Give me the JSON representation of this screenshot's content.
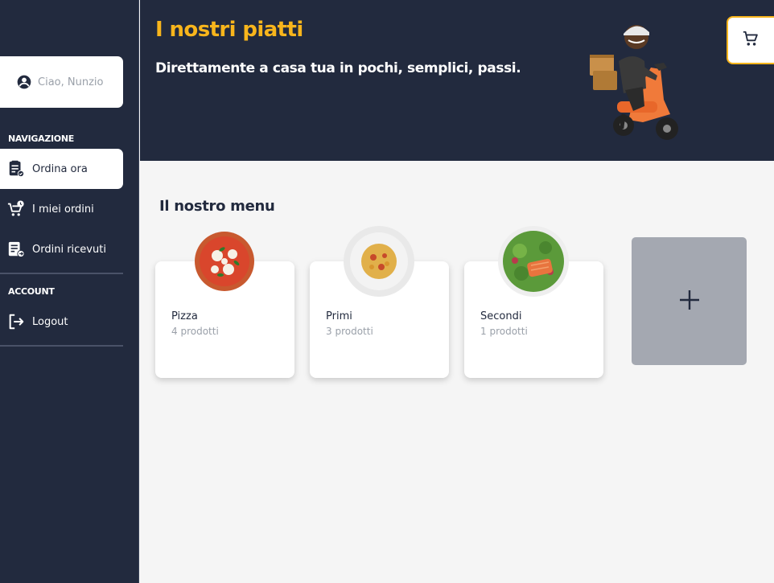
{
  "sidebar": {
    "greeting": "Ciao, Nunzio",
    "nav_section": "NAVIGAZIONE",
    "nav_items": [
      {
        "label": "Ordina ora",
        "icon": "order-list-icon",
        "active": true
      },
      {
        "label": "I miei ordini",
        "icon": "cart-clock-icon",
        "active": false
      },
      {
        "label": "Ordini ricevuti",
        "icon": "received-orders-icon",
        "active": false
      }
    ],
    "account_section": "ACCOUNT",
    "account_items": [
      {
        "label": "Logout",
        "icon": "logout-icon"
      }
    ]
  },
  "hero": {
    "title": "I nostri piatti",
    "subtitle": "Direttamente a casa tua in pochi, semplici, passi."
  },
  "cart": {
    "icon": "cart-icon"
  },
  "menu": {
    "title": "Il nostro menu",
    "categories": [
      {
        "name": "Pizza",
        "count": "4 prodotti"
      },
      {
        "name": "Primi",
        "count": "3 prodotti"
      },
      {
        "name": "Secondi",
        "count": "1 prodotti"
      }
    ],
    "add_icon": "plus-icon"
  },
  "colors": {
    "sidebar_bg": "#222a3e",
    "accent": "#f8b51c",
    "content_bg": "#f5f5f5",
    "add_card": "#a4a8b1"
  }
}
